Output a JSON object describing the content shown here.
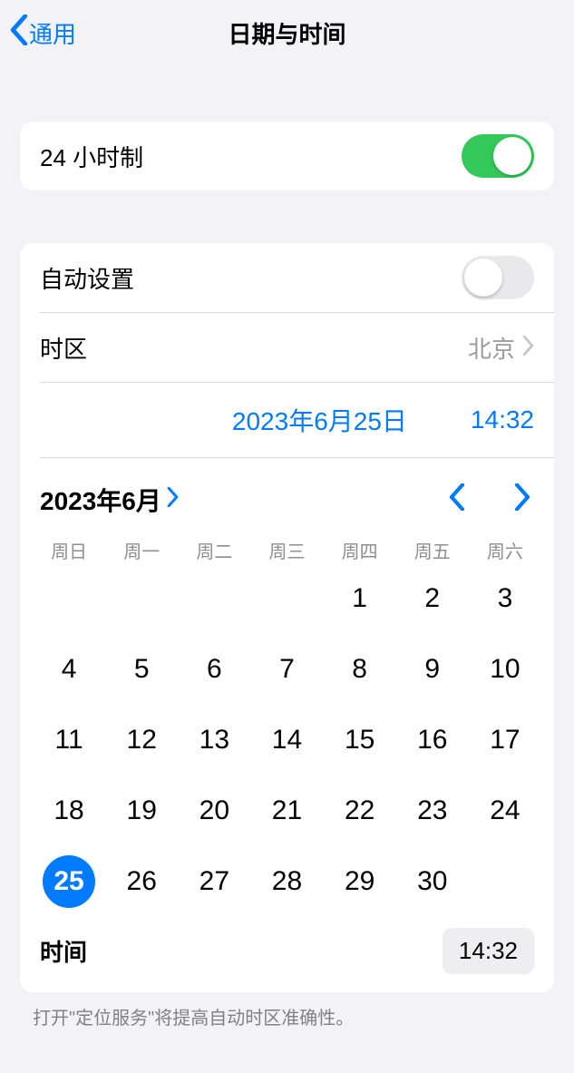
{
  "header": {
    "back_label": "通用",
    "title": "日期与时间"
  },
  "twenty_four": {
    "label": "24 小时制",
    "on": true
  },
  "auto_set": {
    "label": "自动设置",
    "on": false
  },
  "timezone": {
    "label": "时区",
    "value": "北京"
  },
  "selected_display": {
    "date": "2023年6月25日",
    "time": "14:32"
  },
  "calendar": {
    "month_label": "2023年6月",
    "weekdays": [
      "周日",
      "周一",
      "周二",
      "周三",
      "周四",
      "周五",
      "周六"
    ],
    "leading_blanks": 4,
    "days": 30,
    "selected_day": 25
  },
  "time_row": {
    "label": "时间",
    "value": "14:32"
  },
  "footnote": "打开\"定位服务\"将提高自动时区准确性。"
}
